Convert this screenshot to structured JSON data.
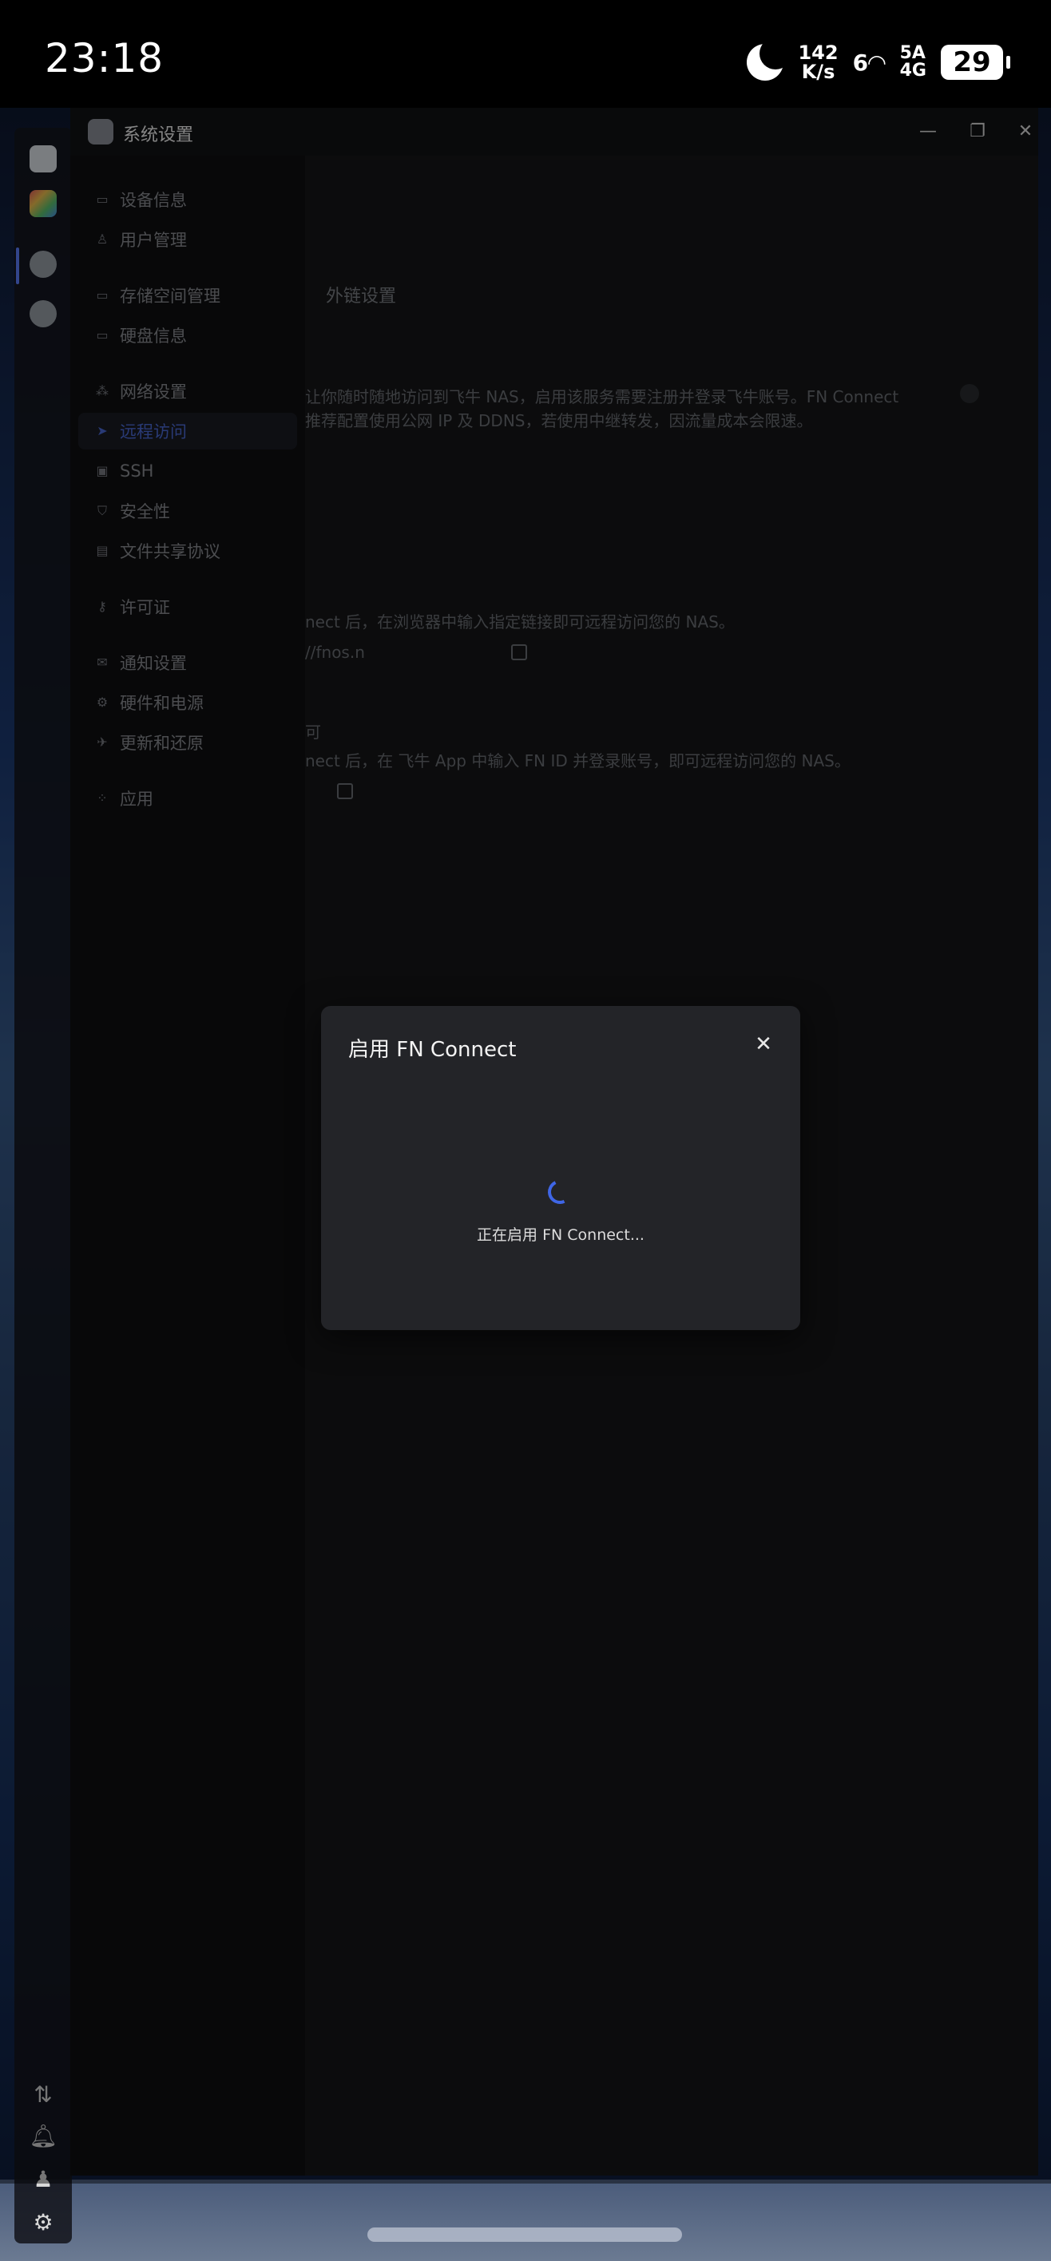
{
  "status_bar": {
    "time": "23:18",
    "net_speed_value": "142",
    "net_speed_unit": "K/s",
    "wifi_label": "6",
    "cell_top": "5A",
    "cell_bottom": "4G",
    "battery": "29"
  },
  "window": {
    "title": "系统设置",
    "minimize_icon": "minimize-icon",
    "maximize_icon": "restore-icon",
    "close_icon": "close-icon"
  },
  "sidebar": {
    "items": [
      {
        "label": "设备信息",
        "icon": "device-icon"
      },
      {
        "label": "用户管理",
        "icon": "user-icon"
      },
      {
        "label": "存储空间管理",
        "icon": "storage-icon"
      },
      {
        "label": "硬盘信息",
        "icon": "disk-icon"
      },
      {
        "label": "网络设置",
        "icon": "network-icon"
      },
      {
        "label": "远程访问",
        "icon": "send-icon"
      },
      {
        "label": "SSH",
        "icon": "terminal-icon"
      },
      {
        "label": "安全性",
        "icon": "shield-icon"
      },
      {
        "label": "文件共享协议",
        "icon": "file-icon"
      },
      {
        "label": "许可证",
        "icon": "key-icon"
      },
      {
        "label": "通知设置",
        "icon": "mail-icon"
      },
      {
        "label": "硬件和电源",
        "icon": "hardware-icon"
      },
      {
        "label": "更新和还原",
        "icon": "rocket-icon"
      },
      {
        "label": "应用",
        "icon": "apps-icon"
      }
    ]
  },
  "content": {
    "tab_external": "外链设置",
    "desc_line1": "让你随时随地访问到飞牛 NAS，启用该服务需要注册并登录飞牛账号。FN Connect",
    "desc_line2": "推荐配置使用公网 IP 及 DDNS，若使用中继转发，因流量成本会限速。",
    "browser_desc": "nect 后，在浏览器中输入指定链接即可远程访问您的 NAS。",
    "browser_link": "//fnos.n",
    "app_title_fragment": "可",
    "app_desc": "nect 后，在 飞牛 App 中输入 FN ID 并登录账号，即可远程访问您的 NAS。"
  },
  "dialog": {
    "title": "启用 FN Connect",
    "message": "正在启用 FN Connect..."
  }
}
